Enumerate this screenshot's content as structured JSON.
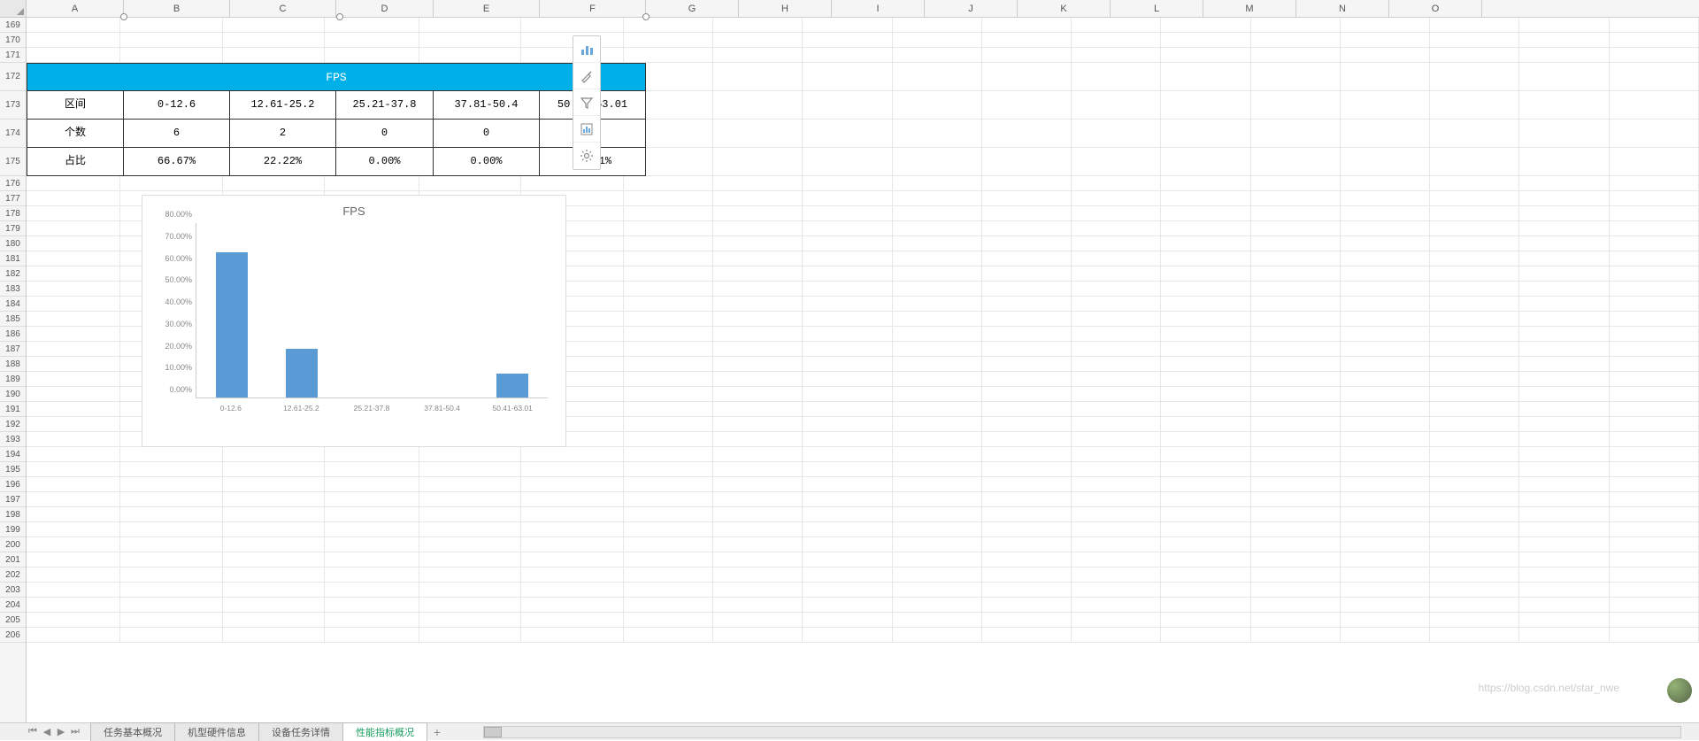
{
  "columns": [
    "A",
    "B",
    "C",
    "D",
    "E",
    "F",
    "G",
    "H",
    "I",
    "J",
    "K",
    "L",
    "M",
    "N",
    "O"
  ],
  "row_start": 169,
  "row_end": 206,
  "table": {
    "title": "FPS",
    "headers_row_label": "区间",
    "count_row_label": "个数",
    "pct_row_label": "占比",
    "bins": [
      "0-12.6",
      "12.61-25.2",
      "25.21-37.8",
      "37.81-50.4",
      "50.41-63.01"
    ],
    "counts": [
      "6",
      "2",
      "0",
      "0",
      "1"
    ],
    "pcts": [
      "66.67%",
      "22.22%",
      "0.00%",
      "0.00%",
      "11.11%"
    ]
  },
  "chart_data": {
    "type": "bar",
    "title": "FPS",
    "categories": [
      "0-12.6",
      "12.61-25.2",
      "25.21-37.8",
      "37.81-50.4",
      "50.41-63.01"
    ],
    "values": [
      66.67,
      22.22,
      0.0,
      0.0,
      11.11
    ],
    "ylabel": "",
    "xlabel": "",
    "ylim": [
      0,
      80
    ],
    "y_ticks": [
      "0.00%",
      "10.00%",
      "20.00%",
      "30.00%",
      "40.00%",
      "50.00%",
      "60.00%",
      "70.00%",
      "80.00%"
    ]
  },
  "float_toolbar": {
    "items": [
      "chart-type-icon",
      "brush-icon",
      "filter-icon",
      "chart-style-icon",
      "gear-icon"
    ]
  },
  "sheet_tabs": {
    "tabs": [
      "任务基本概况",
      "机型硬件信息",
      "设备任务详情",
      "性能指标概况"
    ],
    "active_index": 3,
    "add_label": "+"
  },
  "watermark": "https://blog.csdn.net/star_nwe"
}
